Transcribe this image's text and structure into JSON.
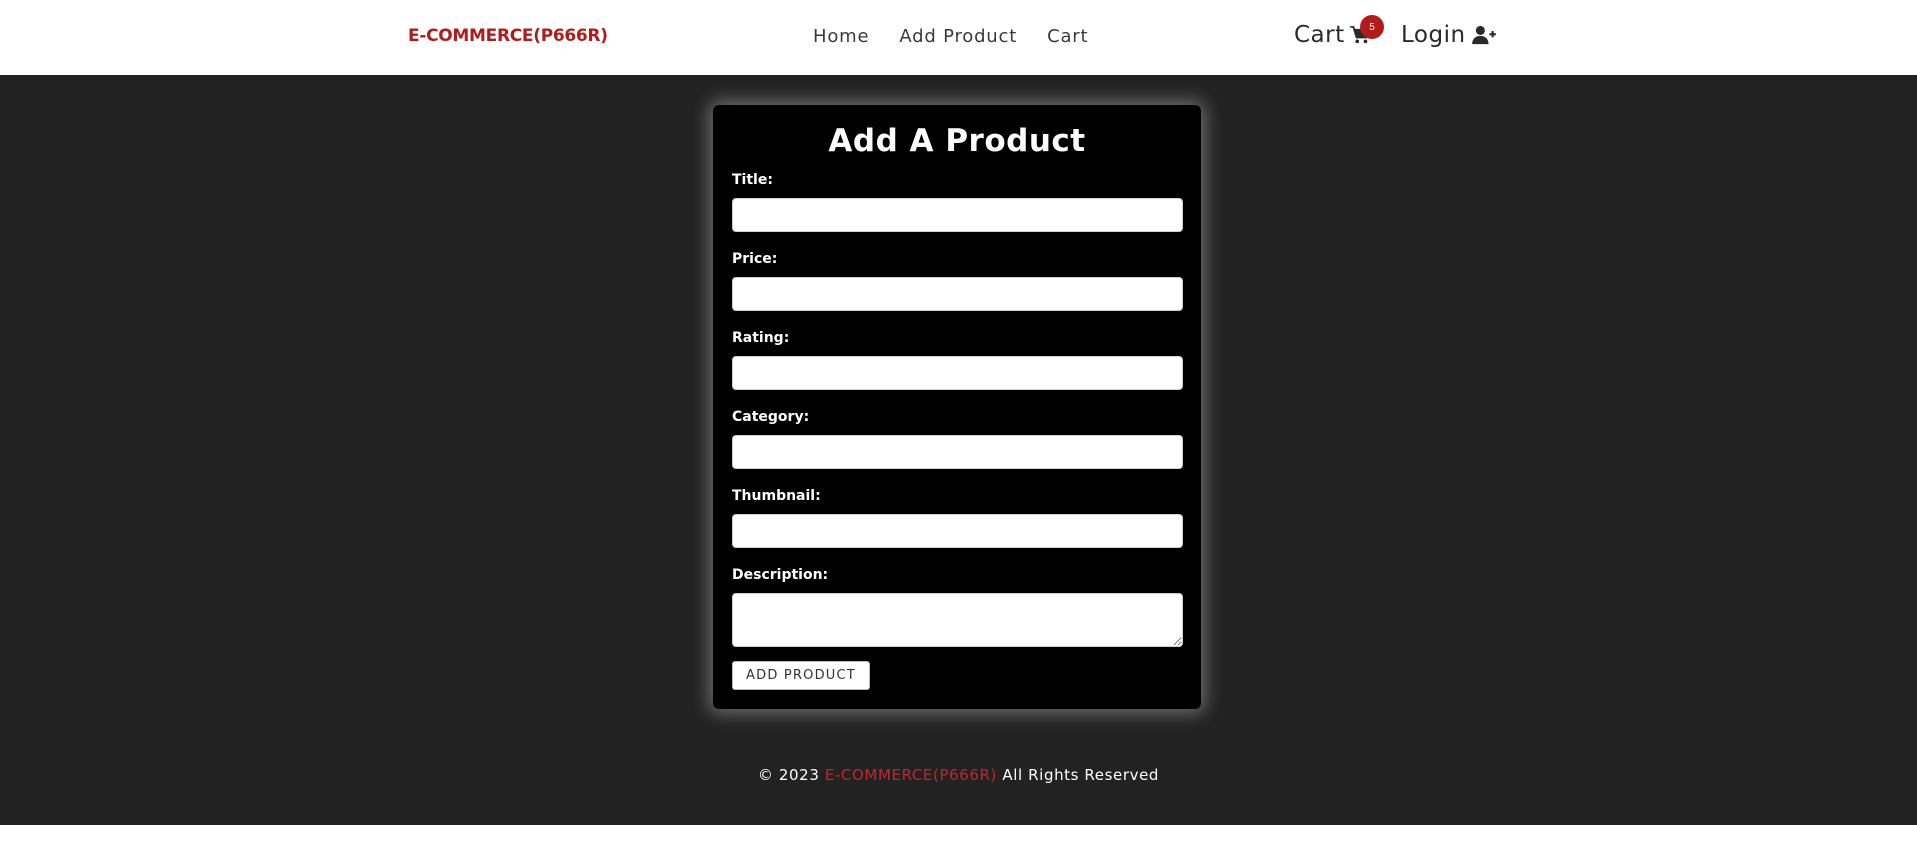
{
  "header": {
    "brand": "E-COMMERCE(P666R)",
    "nav": [
      {
        "label": "Home"
      },
      {
        "label": "Add Product"
      },
      {
        "label": "Cart"
      }
    ],
    "cart_label": "Cart",
    "cart_count": "5",
    "login_label": "Login"
  },
  "form": {
    "title": "Add A Product",
    "fields": [
      {
        "label": "Title:",
        "value": ""
      },
      {
        "label": "Price:",
        "value": ""
      },
      {
        "label": "Rating:",
        "value": ""
      },
      {
        "label": "Category:",
        "value": ""
      },
      {
        "label": "Thumbnail:",
        "value": ""
      },
      {
        "label": "Description:",
        "value": ""
      }
    ],
    "submit_label": "ADD PRODUCT"
  },
  "footer": {
    "prefix": "© 2023",
    "brand": "E-COMMERCE(P666R)",
    "suffix": "All Rights Reserved"
  },
  "colors": {
    "brand_red": "#b31b1b",
    "badge_red": "#b31b1b",
    "footer_brand_red": "#c0262c",
    "page_bg": "#222222",
    "card_bg": "#000000"
  },
  "icons": {
    "cart": "shopping-cart-icon",
    "login": "user-plus-icon"
  }
}
